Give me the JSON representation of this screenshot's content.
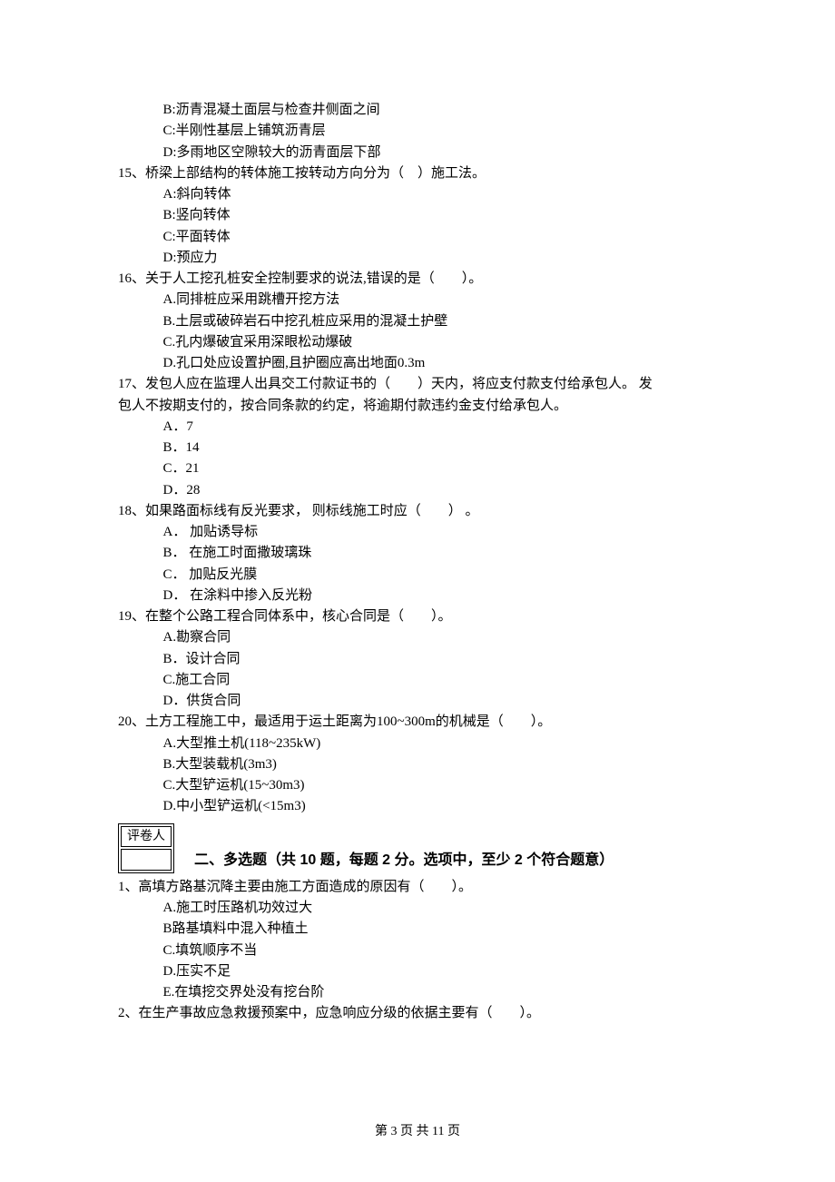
{
  "topOptions": [
    "B:沥青混凝土面层与检查井侧面之间",
    "C:半刚性基层上铺筑沥青层",
    "D:多雨地区空隙较大的沥青面层下部"
  ],
  "questions": [
    {
      "num": "15、",
      "stem": "桥梁上部结构的转体施工按转动方向分为（　）施工法。",
      "options": [
        "A:斜向转体",
        "B:竖向转体",
        "C:平面转体",
        "D:预应力"
      ]
    },
    {
      "num": "16、",
      "stem": "关于人工挖孔桩安全控制要求的说法,错误的是（　　）。",
      "options": [
        "A.同排桩应采用跳槽开挖方法",
        "B.土层或破碎岩石中挖孔桩应采用的混凝土护壁",
        "C.孔内爆破宜采用深眼松动爆破",
        "D.孔口处应设置护圈,且护圈应高出地面0.3m"
      ]
    },
    {
      "num": "17、",
      "stem": "发包人应在监理人出具交工付款证书的（　　）天内，将应支付款支付给承包人。 发",
      "wrap": "包人不按期支付的，按合同条款的约定，将逾期付款违约金支付给承包人。",
      "options": [
        "A．7",
        "B．14",
        "C．21",
        "D．28"
      ]
    },
    {
      "num": "18、",
      "stem": "如果路面标线有反光要求， 则标线施工时应（　　） 。",
      "options": [
        "A． 加贴诱导标",
        "B． 在施工时面撒玻璃珠",
        "C． 加贴反光膜",
        "D． 在涂料中掺入反光粉"
      ]
    },
    {
      "num": "19、",
      "stem": "在整个公路工程合同体系中，核心合同是（　　）。",
      "options": [
        "A.勘察合同",
        "B．设计合同",
        "C.施工合同",
        "D．供货合同"
      ]
    },
    {
      "num": "20、",
      "stem": "土方工程施工中，最适用于运土距离为100~300m的机械是（　　）。",
      "options": [
        "A.大型推土机(118~235kW)",
        "B.大型装载机(3m3)",
        "C.大型铲运机(15~30m3)",
        "D.中小型铲运机(<15m3)"
      ]
    }
  ],
  "grader": {
    "label": "评卷人"
  },
  "section": {
    "heading": "二、多选题（共 10 题，每题 2 分。选项中，至少 2 个符合题意）"
  },
  "mcQuestions": [
    {
      "num": "1、",
      "stem": "高填方路基沉降主要由施工方面造成的原因有（　　）。",
      "options": [
        "A.施工时压路机功效过大",
        "B路基填料中混入种植土",
        "C.填筑顺序不当",
        "D.压实不足",
        "E.在填挖交界处没有挖台阶"
      ]
    },
    {
      "num": "2、",
      "stem": "在生产事故应急救援预案中，应急响应分级的依据主要有（　　）。",
      "options": []
    }
  ],
  "footer": "第 3 页 共 11 页"
}
